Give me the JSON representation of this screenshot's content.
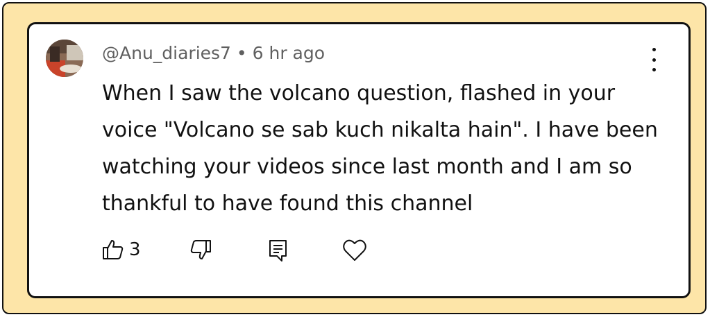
{
  "comment": {
    "author": "@Anu_diaries7",
    "separator": "•",
    "time": "6 hr ago",
    "text": "When I saw the volcano question, flashed in your voice \"Volcano se sab kuch nikalta hain\". I have been watching your videos since last month and I am so thankful to have found this channel",
    "like_count": "3"
  },
  "icons": {
    "like": "thumbs-up-icon",
    "dislike": "thumbs-down-icon",
    "reply": "reply-icon",
    "heart": "heart-icon",
    "more": "more-vertical-icon"
  },
  "colors": {
    "frame_background": "#fde5a8",
    "card_background": "#ffffff",
    "meta_text": "#5f5f5f",
    "body_text": "#111111"
  }
}
